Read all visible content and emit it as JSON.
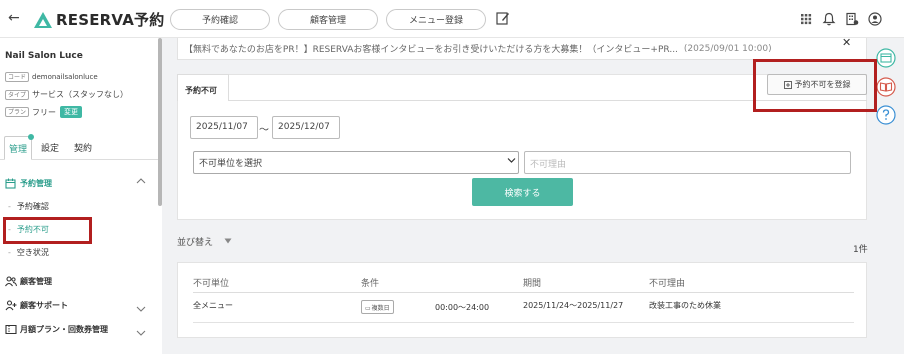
{
  "header": {
    "back_glyph": "←",
    "logo_text": "RESERVA予約",
    "nav": [
      "予約確認",
      "顧客管理",
      "メニュー登録"
    ],
    "icons": [
      "grid-icon",
      "bell-icon",
      "building-icon",
      "account-icon"
    ]
  },
  "announcement": {
    "text": "【無料であなたのお店をPR！】RESERVAお客様インタビューをお引き受けいただける方を大募集！（インタビュー+PR...",
    "date": "(2025/09/01 10:00)",
    "close_glyph": "✕"
  },
  "sidebar": {
    "salon_name": "Nail Salon Luce",
    "code_tag": "コード",
    "code_value": "demonailsalonluce",
    "type_tag": "タイプ",
    "type_value": "サービス（スタッフなし）",
    "plan_tag": "プラン",
    "plan_value": "フリー",
    "change_label": "変更",
    "tabs": [
      "管理",
      "設定",
      "契約"
    ],
    "groups": {
      "reservation": "予約管理",
      "customer": "顧客管理",
      "support": "顧客サポート",
      "plan": "月額プラン・回数券管理"
    },
    "sub_items": [
      "予約確認",
      "予約不可",
      "空き状況"
    ]
  },
  "panel": {
    "tab_label": "予約不可",
    "register_button": "予約不可を登録",
    "date_from": "2025/11/07",
    "tilde": "〜",
    "date_to": "2025/12/07",
    "unit_select": "不可単位を選択",
    "reason_placeholder": "不可理由",
    "search_button": "検索する"
  },
  "list": {
    "sort_label": "並び替え",
    "count": "1件",
    "columns": [
      "不可単位",
      "条件",
      "期間",
      "不可理由"
    ],
    "rows": [
      {
        "unit": "全メニュー",
        "condition_badge": "複数日",
        "time": "00:00〜24:00",
        "period": "2025/11/24〜2025/11/27",
        "reason": "改装工事のため休業"
      }
    ]
  },
  "colors": {
    "accent": "#3fb8a4",
    "highlight_border": "#b21f1f"
  }
}
